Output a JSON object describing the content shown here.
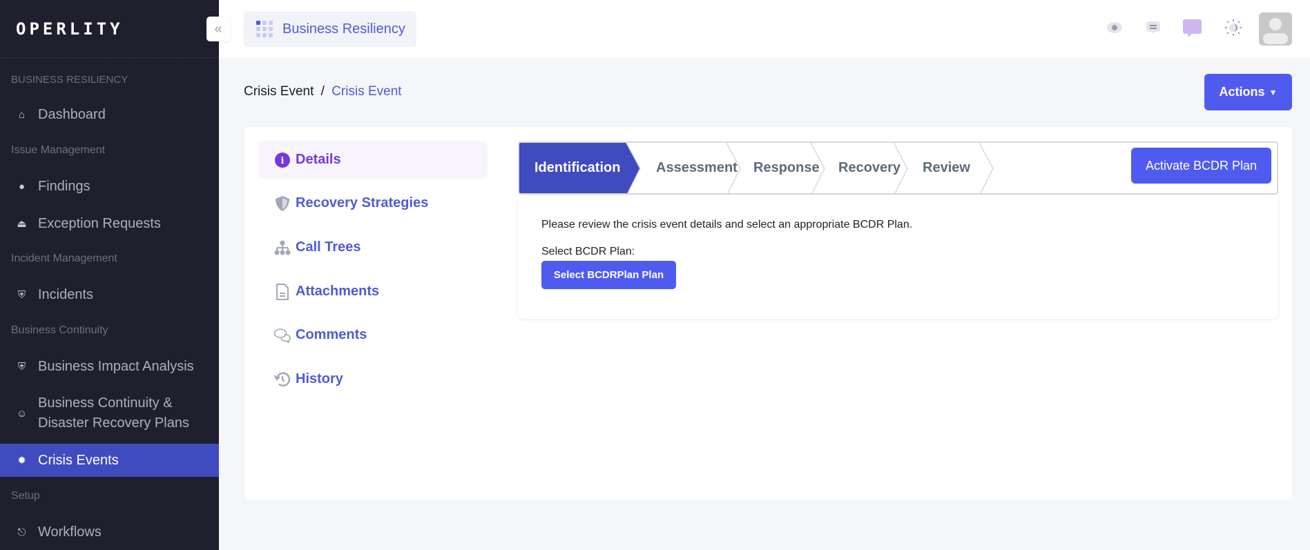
{
  "sidebar": {
    "logo": "OPERLITY",
    "sections": [
      {
        "label": "BUSINESS RESILIENCY",
        "items": [
          {
            "label": "Dashboard",
            "icon": "home-icon"
          }
        ]
      },
      {
        "label": "Issue Management",
        "items": [
          {
            "label": "Findings",
            "icon": "alert-circle-icon"
          },
          {
            "label": "Exception Requests",
            "icon": "eject-icon"
          }
        ]
      },
      {
        "label": "Incident Management",
        "items": [
          {
            "label": "Incidents",
            "icon": "shield-icon"
          }
        ]
      },
      {
        "label": "Business Continuity",
        "items": [
          {
            "label": "Business Impact Analysis",
            "icon": "shield-virus-icon"
          },
          {
            "label": "Business Continuity &",
            "label2": "Disaster Recovery Plans",
            "icon": "masks-icon"
          },
          {
            "label": "Crisis Events",
            "icon": "virus-icon",
            "active": true
          }
        ]
      },
      {
        "label": "Setup",
        "items": [
          {
            "label": "Workflows",
            "icon": "workflow-icon"
          }
        ]
      }
    ]
  },
  "header": {
    "module": "Business Resiliency",
    "icons": [
      "eye-icon",
      "message-icon",
      "chat-icon",
      "theme-toggle-icon",
      "avatar"
    ],
    "chat_color": "#cdb8f2"
  },
  "breadcrumb": {
    "parent": "Crisis Event",
    "separator": "/",
    "current": "Crisis Event"
  },
  "actions_label": "Actions",
  "tabs": [
    {
      "label": "Details",
      "icon": "info-icon",
      "active": true
    },
    {
      "label": "Recovery Strategies",
      "icon": "shield-half-icon"
    },
    {
      "label": "Call Trees",
      "icon": "sitemap-icon"
    },
    {
      "label": "Attachments",
      "icon": "file-icon"
    },
    {
      "label": "Comments",
      "icon": "comments-icon"
    },
    {
      "label": "History",
      "icon": "history-icon"
    }
  ],
  "stepper": {
    "steps": [
      "Identification",
      "Assessment",
      "Response",
      "Recovery",
      "Review"
    ],
    "active_index": 0,
    "activate_label": "Activate BCDR Plan"
  },
  "details": {
    "instruction": "Please review the crisis event details and select an appropriate BCDR Plan.",
    "select_label": "Select BCDR Plan:",
    "select_button": "Select BCDRPlan Plan"
  },
  "colors": {
    "accent": "#4f5bef",
    "sidebar_bg": "#1f1f2d",
    "active_item": "#3f4bbf",
    "active_tab": "#7439d6"
  }
}
